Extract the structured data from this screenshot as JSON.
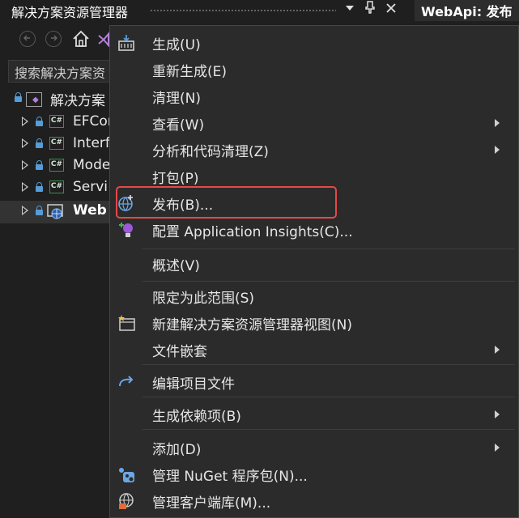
{
  "panel": {
    "title": "解决方案资源管理器",
    "document_tab": "WebApi: 发布",
    "search_placeholder": "搜索解决方案资"
  },
  "tree": {
    "solution_label": "解决方案",
    "projects": [
      {
        "label": "EFCor",
        "icon": "csharp-project-icon",
        "text": "C#"
      },
      {
        "label": "Interf",
        "icon": "csharp-project-icon",
        "text": "C#"
      },
      {
        "label": "Mode",
        "icon": "csharp-project-icon",
        "text": "C#"
      },
      {
        "label": "Servi",
        "icon": "csharp-project-icon",
        "text": "C#"
      },
      {
        "label": "Web",
        "icon": "web-project-icon",
        "selected": true
      }
    ]
  },
  "right_edge_fragment": "I",
  "context_menu": {
    "items": [
      {
        "label": "生成(U)",
        "icon": "build-icon"
      },
      {
        "label": "重新生成(E)"
      },
      {
        "label": "清理(N)"
      },
      {
        "label": "查看(W)",
        "submenu": true
      },
      {
        "label": "分析和代码清理(Z)",
        "submenu": true
      },
      {
        "label": "打包(P)"
      },
      {
        "label": "发布(B)...",
        "icon": "publish-globe-icon",
        "highlighted": true
      },
      {
        "label": "配置 Application Insights(C)...",
        "icon": "application-insights-icon"
      },
      {
        "label": "概述(V)"
      },
      {
        "label": "限定为此范围(S)"
      },
      {
        "label": "新建解决方案资源管理器视图(N)",
        "icon": "new-view-icon"
      },
      {
        "label": "文件嵌套",
        "submenu": true
      },
      {
        "label": "编辑项目文件",
        "icon": "redo-arrow-icon"
      },
      {
        "label": "生成依赖项(B)",
        "submenu": true
      },
      {
        "label": "添加(D)",
        "submenu": true
      },
      {
        "label": "管理 NuGet 程序包(N)...",
        "icon": "nuget-icon"
      },
      {
        "label": "管理客户端库(M)...",
        "icon": "client-library-icon"
      }
    ]
  },
  "colors": {
    "background": "#1f1f1f",
    "menu_background": "#2b2b2b",
    "highlight_border": "#e54848",
    "lock_blue": "#569cd6",
    "csharp_green": "#3c8f4e",
    "vs_purple": "#b180d7"
  }
}
